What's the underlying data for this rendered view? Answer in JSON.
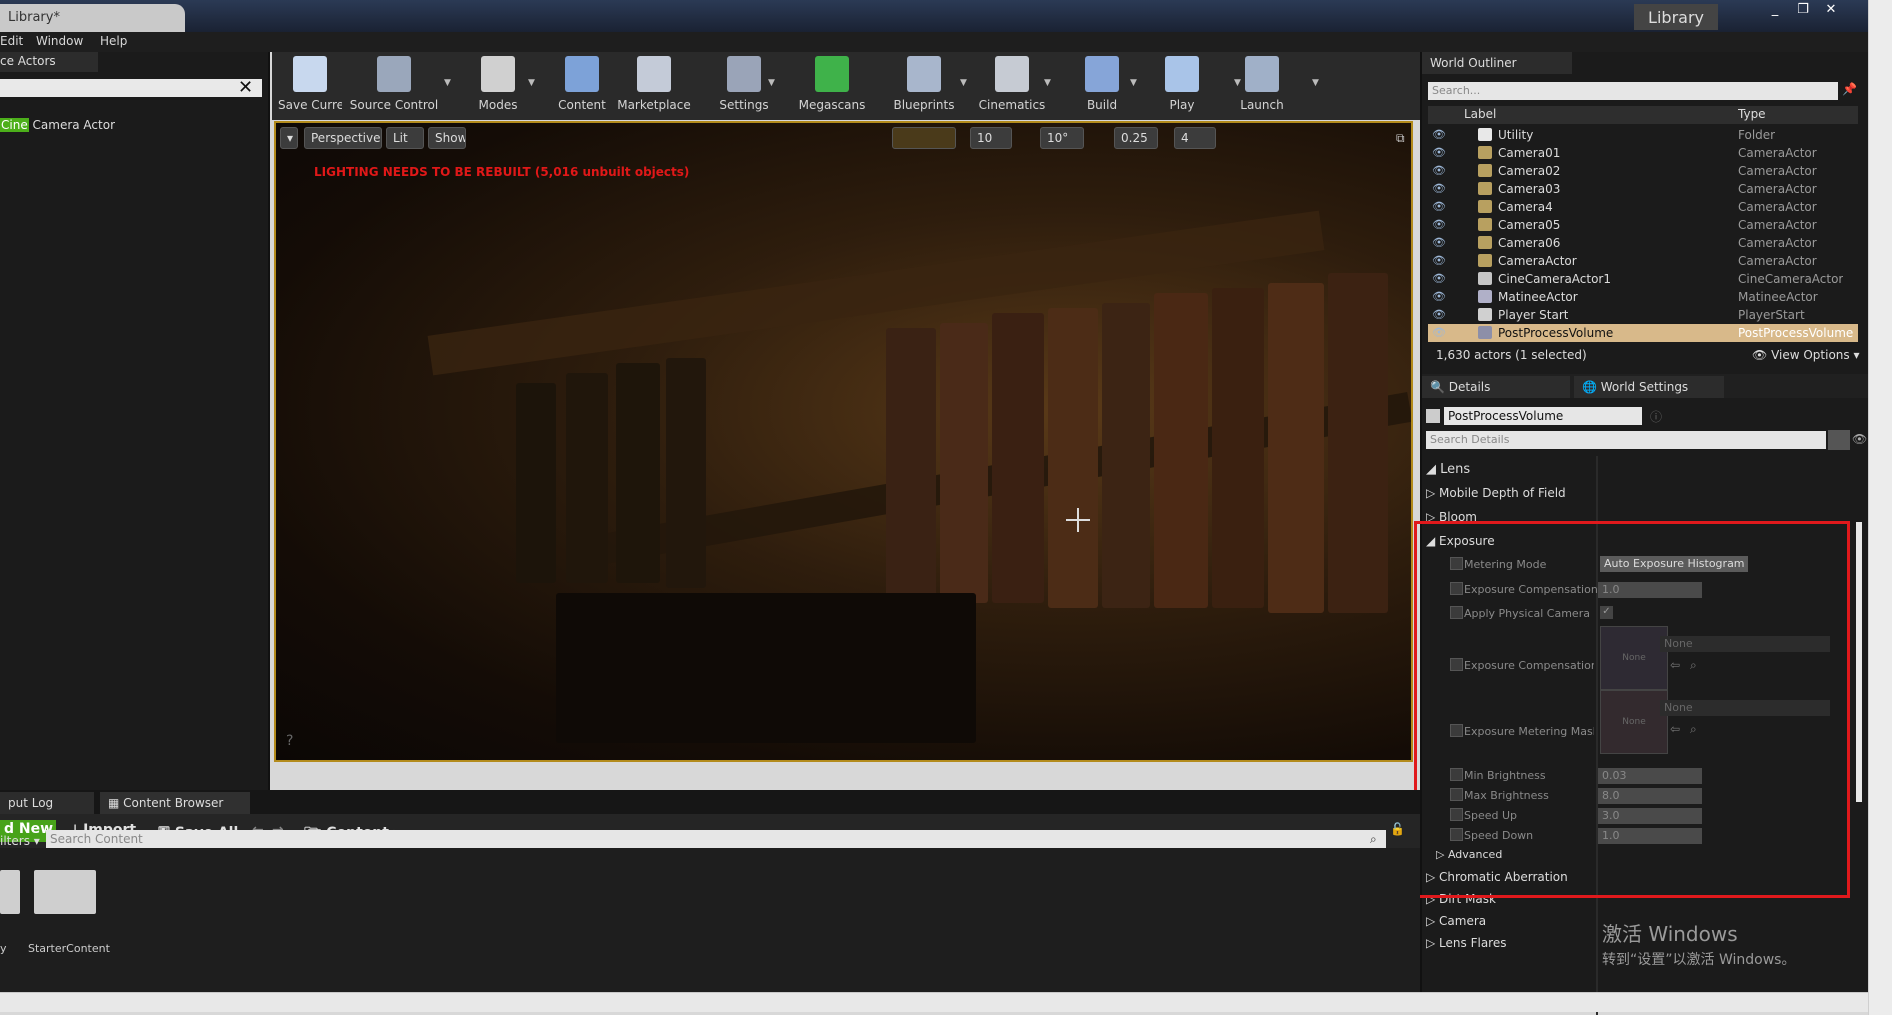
{
  "window": {
    "tab_title": "Library*",
    "title_right": "Library",
    "controls": [
      "_",
      "❐",
      "✕"
    ]
  },
  "menu": [
    "Edit",
    "Window",
    "Help"
  ],
  "left_panel": {
    "tab": "ce Actors",
    "item_prefix": "Cine",
    "item_rest": " Camera Actor"
  },
  "toolbar": [
    {
      "label": "Save Current",
      "icon": "save-icon",
      "color": "#c8d8ee"
    },
    {
      "label": "Source Control",
      "icon": "source-control-icon",
      "color": "#9aa7bb"
    },
    {
      "label": "Modes",
      "icon": "modes-icon",
      "color": "#d0d0d0"
    },
    {
      "label": "Content",
      "icon": "content-icon",
      "color": "#7da2d8"
    },
    {
      "label": "Marketplace",
      "icon": "marketplace-icon",
      "color": "#c4cbd8"
    },
    {
      "label": "Settings",
      "icon": "settings-icon",
      "color": "#9aa4b8"
    },
    {
      "label": "Megascans",
      "icon": "megascans-icon",
      "color": "#3fb24a"
    },
    {
      "label": "Blueprints",
      "icon": "blueprints-icon",
      "color": "#a8b6cc"
    },
    {
      "label": "Cinematics",
      "icon": "cinematics-icon",
      "color": "#c6cbd3"
    },
    {
      "label": "Build",
      "icon": "build-icon",
      "color": "#86a5d8"
    },
    {
      "label": "Play",
      "icon": "play-icon",
      "color": "#a9c4e8"
    },
    {
      "label": "Launch",
      "icon": "launch-icon",
      "color": "#a0b0c8"
    }
  ],
  "viewport": {
    "perspective": "Perspective",
    "lit": "Lit",
    "show": "Show",
    "warning": "LIGHTING NEEDS TO BE REBUILT (5,016 unbuilt objects)",
    "grid_snap": "10",
    "rotation_snap": "10°",
    "scale_snap": "0.25",
    "camera_speed": "4"
  },
  "outliner": {
    "tab": "World Outliner",
    "search_placeholder": "Search...",
    "col_label": "Label",
    "col_type": "Type",
    "rows": [
      {
        "label": "Utility",
        "type": "Folder"
      },
      {
        "label": "Camera01",
        "type": "CameraActor"
      },
      {
        "label": "Camera02",
        "type": "CameraActor"
      },
      {
        "label": "Camera03",
        "type": "CameraActor"
      },
      {
        "label": "Camera4",
        "type": "CameraActor"
      },
      {
        "label": "Camera05",
        "type": "CameraActor"
      },
      {
        "label": "Camera06",
        "type": "CameraActor"
      },
      {
        "label": "CameraActor",
        "type": "CameraActor"
      },
      {
        "label": "CineCameraActor1",
        "type": "CineCameraActor"
      },
      {
        "label": "MatineeActor",
        "type": "MatineeActor"
      },
      {
        "label": "Player Start",
        "type": "PlayerStart"
      },
      {
        "label": "PostProcessVolume",
        "type": "PostProcessVolume"
      }
    ],
    "count": "1,630 actors (1 selected)",
    "view_options": "View Options"
  },
  "details": {
    "tab": "Details",
    "tab2": "World Settings",
    "object_name": "PostProcessVolume",
    "search_placeholder": "Search Details",
    "lens": "Lens",
    "categories_top": [
      "Mobile Depth of Field",
      "Bloom"
    ],
    "exposure": "Exposure",
    "metering_mode_label": "Metering Mode",
    "metering_mode_value": "Auto Exposure Histogram",
    "exp_comp_label": "Exposure Compensation",
    "exp_comp_value": "1.0",
    "apply_phys_label": "Apply Physical Camera Ex",
    "exp_comp_curve_label": "Exposure Compensation C",
    "exp_mask_label": "Exposure Metering Mask",
    "none": "None",
    "min_brightness_label": "Min Brightness",
    "min_brightness_value": "0.03",
    "max_brightness_label": "Max Brightness",
    "max_brightness_value": "8.0",
    "speed_up_label": "Speed Up",
    "speed_up_value": "3.0",
    "speed_down_label": "Speed Down",
    "speed_down_value": "1.0",
    "advanced": "Advanced",
    "categories_bottom": [
      "Chromatic Aberration",
      "Dirt Mask",
      "Camera",
      "Lens Flares"
    ]
  },
  "content_browser": {
    "tab_output": "put Log",
    "tab_content": "Content Browser",
    "add_new": "d New",
    "import": "Import",
    "save_all": "Save All",
    "path": "Content",
    "filters": "ilters",
    "search_placeholder": "Search Content",
    "folders": [
      "y",
      "StarterContent"
    ]
  },
  "watermark": {
    "line1": "激活 Windows",
    "line2": "转到“设置”以激活 Windows。"
  }
}
